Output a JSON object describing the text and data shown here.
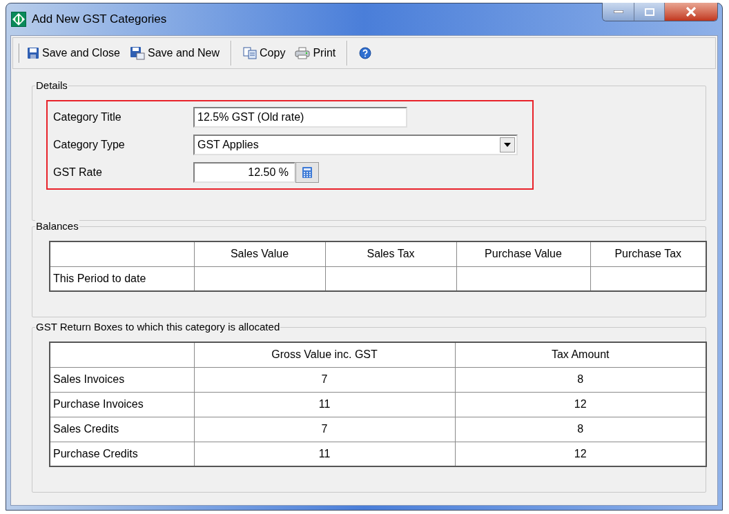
{
  "window": {
    "title": "Add New GST Categories"
  },
  "toolbar": [
    {
      "kind": "save-close",
      "label": "Save and Close"
    },
    {
      "kind": "save-new",
      "label": "Save and New"
    },
    {
      "kind": "separator"
    },
    {
      "kind": "copy",
      "label": "Copy"
    },
    {
      "kind": "print",
      "label": "Print"
    },
    {
      "kind": "separator"
    },
    {
      "kind": "help"
    }
  ],
  "details": {
    "title": "Details",
    "highlighted": true,
    "fields": [
      {
        "kind": "text",
        "label": "Category Title",
        "value": "12.5% GST (Old rate)"
      },
      {
        "kind": "dropdown",
        "label": "Category Type",
        "value": "GST Applies"
      },
      {
        "kind": "rate",
        "label": "GST Rate",
        "value": "12.50 %"
      }
    ]
  },
  "balances": {
    "title": "Balances",
    "columns": [
      "Sales Value",
      "Sales Tax",
      "Purchase Value",
      "Purchase Tax"
    ],
    "rows": [
      {
        "label": "This Period to date",
        "cells": [
          "",
          "",
          "",
          ""
        ]
      }
    ]
  },
  "return_boxes": {
    "title": "GST Return Boxes to which this category is allocated",
    "columns": [
      "Gross Value inc. GST",
      "Tax Amount"
    ],
    "rows": [
      {
        "label": "Sales Invoices",
        "cells": [
          "7",
          "8"
        ]
      },
      {
        "label": "Purchase Invoices",
        "cells": [
          "11",
          "12"
        ]
      },
      {
        "label": "Sales Credits",
        "cells": [
          "7",
          "8"
        ]
      },
      {
        "label": "Purchase Credits",
        "cells": [
          "11",
          "12"
        ]
      }
    ]
  }
}
